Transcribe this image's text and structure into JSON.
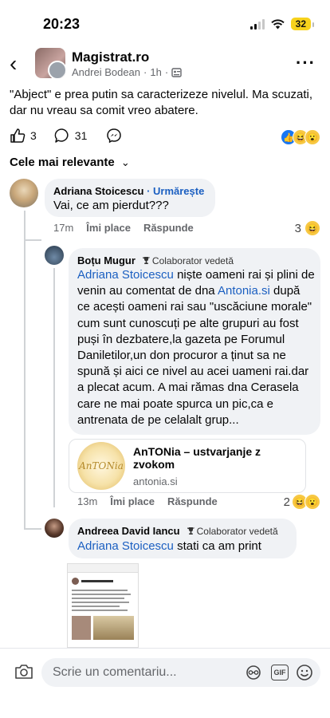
{
  "status": {
    "time": "20:23",
    "battery": "32"
  },
  "post": {
    "title": "Magistrat.ro",
    "author": "Andrei Bodean",
    "age": "1h",
    "text": "\"Abject\" e prea putin sa caracterizeze nivelul. Ma scuzati, dar nu vreau sa comit vreo abatere.",
    "likes": "3",
    "comments": "31"
  },
  "sort_label": "Cele mai relevante",
  "comments": [
    {
      "name": "Adriana Stoicescu",
      "follow": "· Urmărește",
      "text": "Vai, ce am pierdut???",
      "time": "17m",
      "like": "Îmi place",
      "reply": "Răspunde",
      "reactions": "3"
    }
  ],
  "replies": [
    {
      "name": "Boțu Mugur",
      "badge": "Colaborator vedetă",
      "mention": "Adriana Stoicescu",
      "text_a": " niște oameni rai și plini de venin au comentat de dna ",
      "mention2": "Antonia.si",
      "text_b": " după ce acești oameni rai sau \"uscăciune morale\" cum sunt cunoscuți pe alte grupuri au fost puși în dezbatere,la gazeta pe Forumul Daniletilor,un don procuror a ținut sa ne spună și aici ce nivel au acei uameni rai.dar a plecat acum. A mai rămas dna Cerasela care ne mai poate spurca un pic,ca e antrenata de pe celalalt grup...",
      "link_title": "AnTONia – ustvarjanje z zvokom",
      "link_domain": "antonia.si",
      "link_thumb_text": "AnTONia",
      "time": "13m",
      "like": "Îmi place",
      "reply": "Răspunde",
      "reactions": "2"
    },
    {
      "name": "Andreea David Iancu",
      "badge": "Colaborator vedetă",
      "mention": "Adriana Stoicescu",
      "text": " stati ca am print"
    }
  ],
  "composer": {
    "placeholder": "Scrie un comentariu..."
  },
  "colors": {
    "link": "#1b5fc1",
    "like_blue": "#1877f2",
    "battery": "#f7d21c"
  }
}
